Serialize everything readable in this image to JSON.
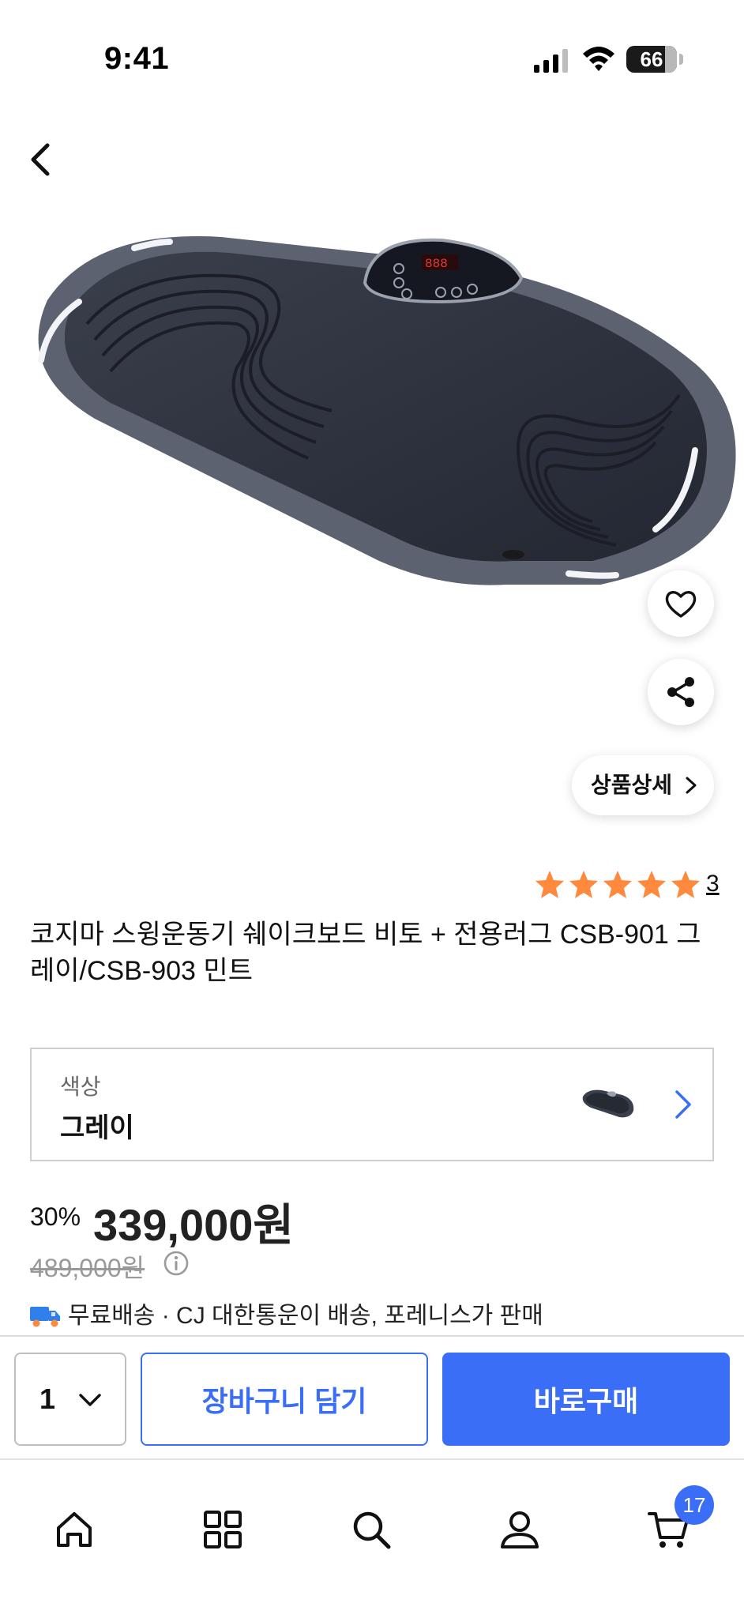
{
  "status_bar": {
    "time": "9:41",
    "battery": "66"
  },
  "product": {
    "title": "코지마 스윙운동기 쉐이크보드 비토 + 전용러그 CSB-901 그레이/CSB-903 민트",
    "rating": {
      "stars": 5,
      "count": "3"
    },
    "detail_button_label": "상품상세"
  },
  "option": {
    "label": "색상",
    "value": "그레이"
  },
  "price": {
    "discount_rate": "30%",
    "sale_price": "339,000원",
    "original_price": "489,000원"
  },
  "shipping": {
    "text": "무료배송 · CJ 대한통운이 배송, 포레니스가 판매"
  },
  "purchase_bar": {
    "quantity": "1",
    "cart_button_label": "장바구니 담기",
    "buy_button_label": "바로구매"
  },
  "tab_bar": {
    "cart_badge": "17"
  },
  "colors": {
    "accent": "#3b6ef6",
    "star": "#ff8a3d",
    "product_dark": "#2b2f3a"
  },
  "icons": [
    "back-arrow-icon",
    "heart-icon",
    "share-icon",
    "chevron-right-icon",
    "info-icon",
    "truck-icon",
    "chevron-down-icon",
    "home-icon",
    "grid-icon",
    "search-icon",
    "person-icon",
    "cart-icon"
  ]
}
